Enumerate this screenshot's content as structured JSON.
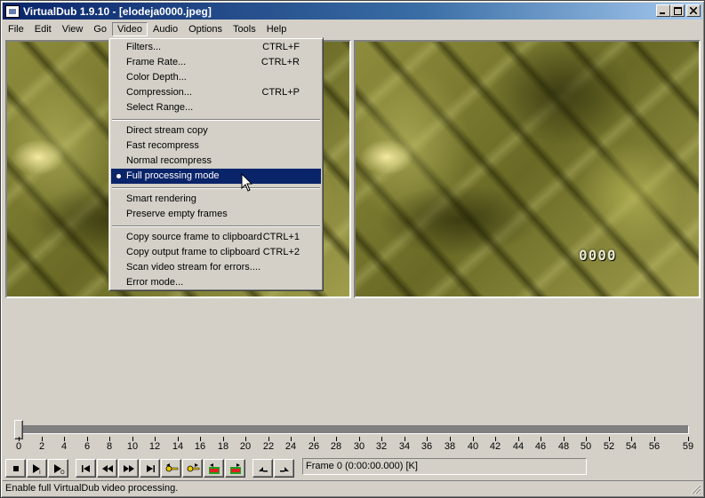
{
  "window": {
    "title": "VirtualDub 1.9.10 - [elodeja0000.jpeg]",
    "controls": {
      "minimize": "_",
      "maximize": "□",
      "close": "×"
    }
  },
  "menubar": {
    "items": [
      "File",
      "Edit",
      "View",
      "Go",
      "Video",
      "Audio",
      "Options",
      "Tools",
      "Help"
    ],
    "open_index": 4
  },
  "video_menu": {
    "groups": [
      [
        {
          "label": "Filters...",
          "shortcut": "CTRL+F"
        },
        {
          "label": "Frame Rate...",
          "shortcut": "CTRL+R"
        },
        {
          "label": "Color Depth...",
          "shortcut": ""
        },
        {
          "label": "Compression...",
          "shortcut": "CTRL+P"
        },
        {
          "label": "Select Range...",
          "shortcut": ""
        }
      ],
      [
        {
          "label": "Direct stream copy",
          "shortcut": ""
        },
        {
          "label": "Fast recompress",
          "shortcut": ""
        },
        {
          "label": "Normal recompress",
          "shortcut": ""
        },
        {
          "label": "Full processing mode",
          "shortcut": "",
          "checked": true,
          "highlighted": true
        }
      ],
      [
        {
          "label": "Smart rendering",
          "shortcut": ""
        },
        {
          "label": "Preserve empty frames",
          "shortcut": ""
        }
      ],
      [
        {
          "label": "Copy source frame to clipboard",
          "shortcut": "CTRL+1"
        },
        {
          "label": "Copy output frame to clipboard",
          "shortcut": "CTRL+2"
        },
        {
          "label": "Scan video stream for errors....",
          "shortcut": ""
        },
        {
          "label": "Error mode...",
          "shortcut": ""
        }
      ]
    ]
  },
  "output_pane": {
    "frame_overlay": "0000"
  },
  "timeline": {
    "position_fraction": 0,
    "tick_labels": [
      "0",
      "2",
      "4",
      "6",
      "8",
      "10",
      "12",
      "14",
      "16",
      "18",
      "20",
      "22",
      "24",
      "26",
      "28",
      "30",
      "32",
      "34",
      "36",
      "38",
      "40",
      "42",
      "44",
      "46",
      "48",
      "50",
      "52",
      "54",
      "56",
      "59"
    ]
  },
  "toolbar": {
    "buttons": [
      "stop-icon",
      "play-input-icon",
      "play-output-icon",
      "go-start-icon",
      "prev-frame-icon",
      "next-frame-icon",
      "go-end-icon",
      "key-prev-icon",
      "key-next-icon",
      "scene-prev-icon",
      "scene-next-icon",
      "mark-in-icon",
      "mark-out-icon"
    ],
    "frame_readout": "Frame 0 (0:00:00.000) [K]"
  },
  "status": {
    "text": "Enable full VirtualDub video processing."
  },
  "colors": {
    "menu_highlight": "#0a246a",
    "face": "#d4d0c8",
    "title_start": "#0a246a",
    "title_end": "#a6caf0"
  }
}
